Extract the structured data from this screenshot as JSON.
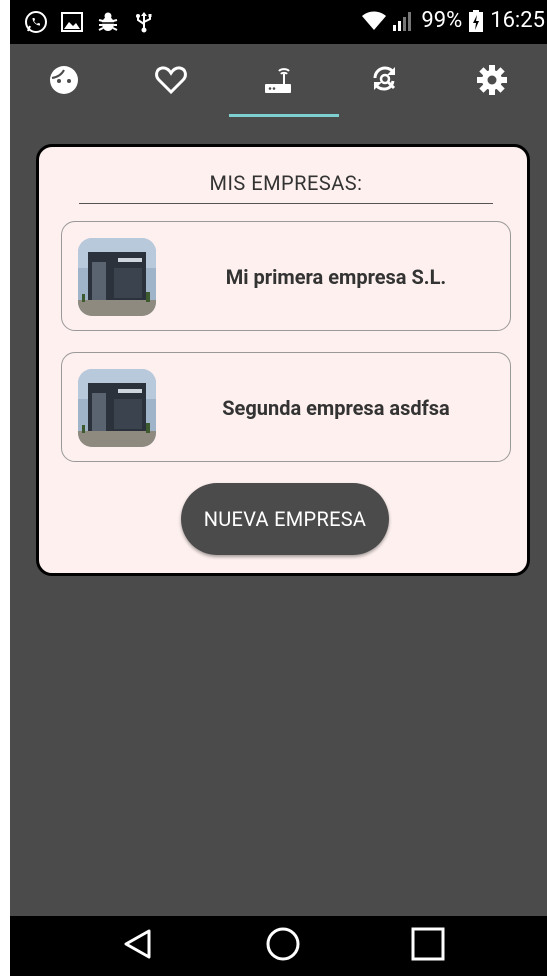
{
  "status_bar": {
    "battery": "99%",
    "time": "16:25",
    "left_icons": [
      "whatsapp-icon",
      "image-icon",
      "bug-icon",
      "usb-icon"
    ],
    "right_icons": [
      "wifi-icon",
      "signal-icon",
      "battery-icon"
    ]
  },
  "top_nav": {
    "items": [
      {
        "icon": "face-icon"
      },
      {
        "icon": "heart-icon"
      },
      {
        "icon": "router-icon",
        "active": true
      },
      {
        "icon": "sync-search-icon"
      },
      {
        "icon": "gear-icon"
      }
    ],
    "indicator_color": "#7ecfcf"
  },
  "card": {
    "title": "MIS EMPRESAS:",
    "companies": [
      {
        "name": "Mi primera empresa S.L.",
        "image": "building-photo"
      },
      {
        "name": "Segunda empresa asdfsa",
        "image": "building-photo"
      }
    ],
    "new_button": "NUEVA EMPRESA"
  },
  "nav_bar": {
    "items": [
      "back-icon",
      "home-icon",
      "recents-icon"
    ]
  },
  "colors": {
    "background": "#4b4b4b",
    "card": "#fdf0ee",
    "accent": "#7ecfcf"
  }
}
